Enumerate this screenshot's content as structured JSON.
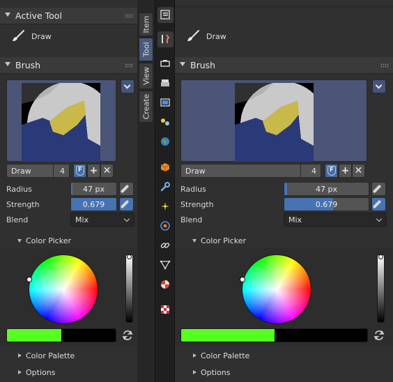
{
  "left_panel": {
    "active_tool": {
      "header": "Active Tool",
      "tool_name": "Draw"
    },
    "brush": {
      "header": "Brush",
      "brush_name": "Draw",
      "users": "4",
      "fake_user": "F",
      "add": "+",
      "remove": "✕"
    },
    "radius": {
      "label": "Radius",
      "value": "47 px",
      "fraction": 0.03
    },
    "strength": {
      "label": "Strength",
      "value": "0.679",
      "fraction": 1.0
    },
    "blend": {
      "label": "Blend",
      "value": "Mix"
    },
    "color_picker": {
      "header": "Color Picker",
      "color": "#55ff22"
    },
    "color_palette": {
      "header": "Color Palette"
    },
    "options": {
      "header": "Options"
    }
  },
  "right_panel": {
    "tool_name": "Draw",
    "brush": {
      "header": "Brush",
      "brush_name": "Draw",
      "users": "4",
      "fake_user": "F",
      "add": "+",
      "remove": "✕"
    },
    "radius": {
      "label": "Radius",
      "value": "47 px",
      "fraction": 0.03
    },
    "strength": {
      "label": "Strength",
      "value": "0.679",
      "fraction": 0.58
    },
    "blend": {
      "label": "Blend",
      "value": "Mix"
    },
    "color_picker": {
      "header": "Color Picker",
      "color": "#55ff22"
    },
    "color_palette": {
      "header": "Color Palette"
    },
    "options": {
      "header": "Options"
    }
  },
  "sidebar_tabs": [
    {
      "label": "Item",
      "active": false
    },
    {
      "label": "Tool",
      "active": true
    },
    {
      "label": "View",
      "active": false
    },
    {
      "label": "Create",
      "active": false
    }
  ],
  "properties_icons": [
    "editor-type-icon",
    "tool-icon",
    "render-icon",
    "output-icon",
    "view-layer-icon",
    "scene-icon",
    "world-icon",
    "object-icon",
    "modifier-icon",
    "particles-icon",
    "physics-icon",
    "constraints-icon",
    "object-data-icon",
    "material-icon",
    "texture-icon"
  ],
  "colors": {
    "accent_blue": "#4772b3",
    "panel_bg": "#303030",
    "header_bg": "#3a3a3a",
    "preview_bg": "#4a5577"
  }
}
